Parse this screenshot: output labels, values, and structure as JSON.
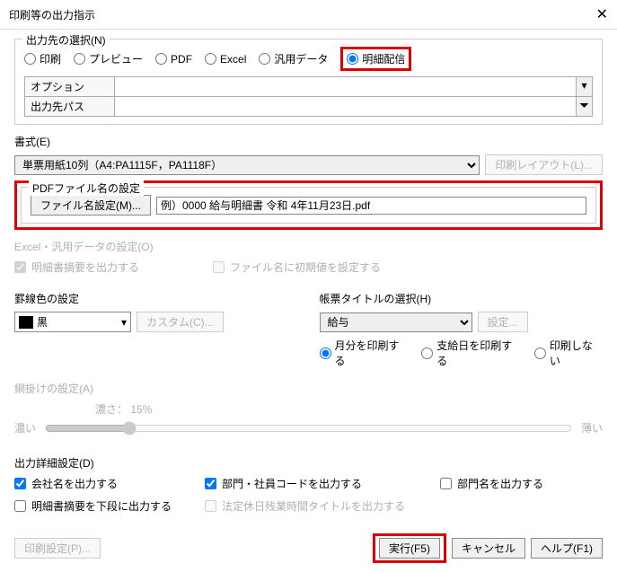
{
  "title": "印刷等の出力指示",
  "dest": {
    "legend": "出力先の選択(N)",
    "options": [
      "印刷",
      "プレビュー",
      "PDF",
      "Excel",
      "汎用データ",
      "明細配信"
    ],
    "opt_label": "オプション",
    "path_label": "出力先パス"
  },
  "format": {
    "label": "書式(E)",
    "value": "単票用紙10列（A4:PA1115F，PA1118F）",
    "layout_btn": "印刷レイアウト(L)..."
  },
  "pdf": {
    "legend": "PDFファイル名の設定",
    "btn": "ファイル名設定(M)...",
    "example": "例）0000 給与明細書 令和 4年11月23日.pdf"
  },
  "excel": {
    "legend": "Excel・汎用データの設定(O)",
    "chk1": "明細書摘要を出力する",
    "chk2": "ファイル名に初期値を設定する"
  },
  "rule": {
    "legend": "罫線色の設定",
    "color": "黒",
    "custom_btn": "カスタム(C)..."
  },
  "report": {
    "legend": "帳票タイトルの選択(H)",
    "value": "給与",
    "setting_btn": "設定...",
    "r1": "月分を印刷する",
    "r2": "支給日を印刷する",
    "r3": "印刷しない"
  },
  "shade": {
    "legend": "網掛けの設定(A)",
    "density_label": "濃さ：",
    "density_value": "15%",
    "dark": "濃い",
    "light": "薄い"
  },
  "detail": {
    "legend": "出力詳細設定(D)",
    "c1": "会社名を出力する",
    "c2": "部門・社員コードを出力する",
    "c3": "部門名を出力する",
    "c4": "明細書摘要を下段に出力する",
    "c5": "法定休日残業時間タイトルを出力する"
  },
  "buttons": {
    "print_setting": "印刷設定(P)...",
    "execute": "実行(F5)",
    "cancel": "キャンセル",
    "help": "ヘルプ(F1)"
  }
}
